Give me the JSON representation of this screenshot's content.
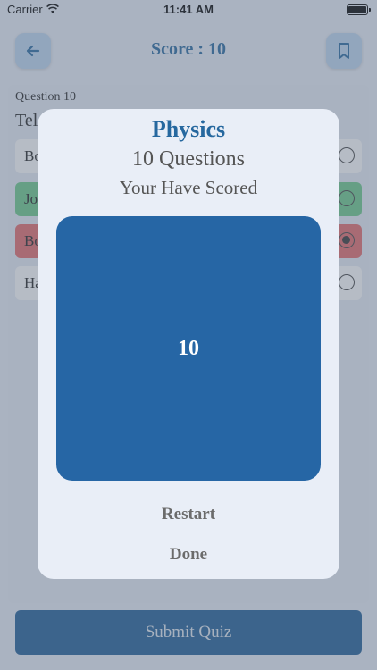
{
  "status_bar": {
    "carrier": "Carrier",
    "time": "11:41 AM"
  },
  "header": {
    "title": "Score : 10",
    "back_icon": "arrow-left-icon",
    "bookmark_icon": "bookmark-icon"
  },
  "question": {
    "label": "Question 10",
    "text_visible": "Tel",
    "options": [
      {
        "text_visible": "Bo",
        "state": "default",
        "selected": false
      },
      {
        "text_visible": "Jo",
        "state": "correct",
        "selected": false
      },
      {
        "text_visible": "Bo",
        "state": "wrong",
        "selected": true
      },
      {
        "text_visible": "Ha",
        "state": "default",
        "selected": false
      }
    ]
  },
  "submit_label": "Submit Quiz",
  "modal": {
    "subject": "Physics",
    "questions": "10 Questions",
    "scored_label": "Your Have Scored",
    "score": "10",
    "restart_label": "Restart",
    "done_label": "Done"
  },
  "colors": {
    "accent": "#26689f",
    "score_box": "#2666a5",
    "correct": "#6cc98a",
    "wrong": "#e66a6a",
    "submit": "#1f5d96"
  }
}
